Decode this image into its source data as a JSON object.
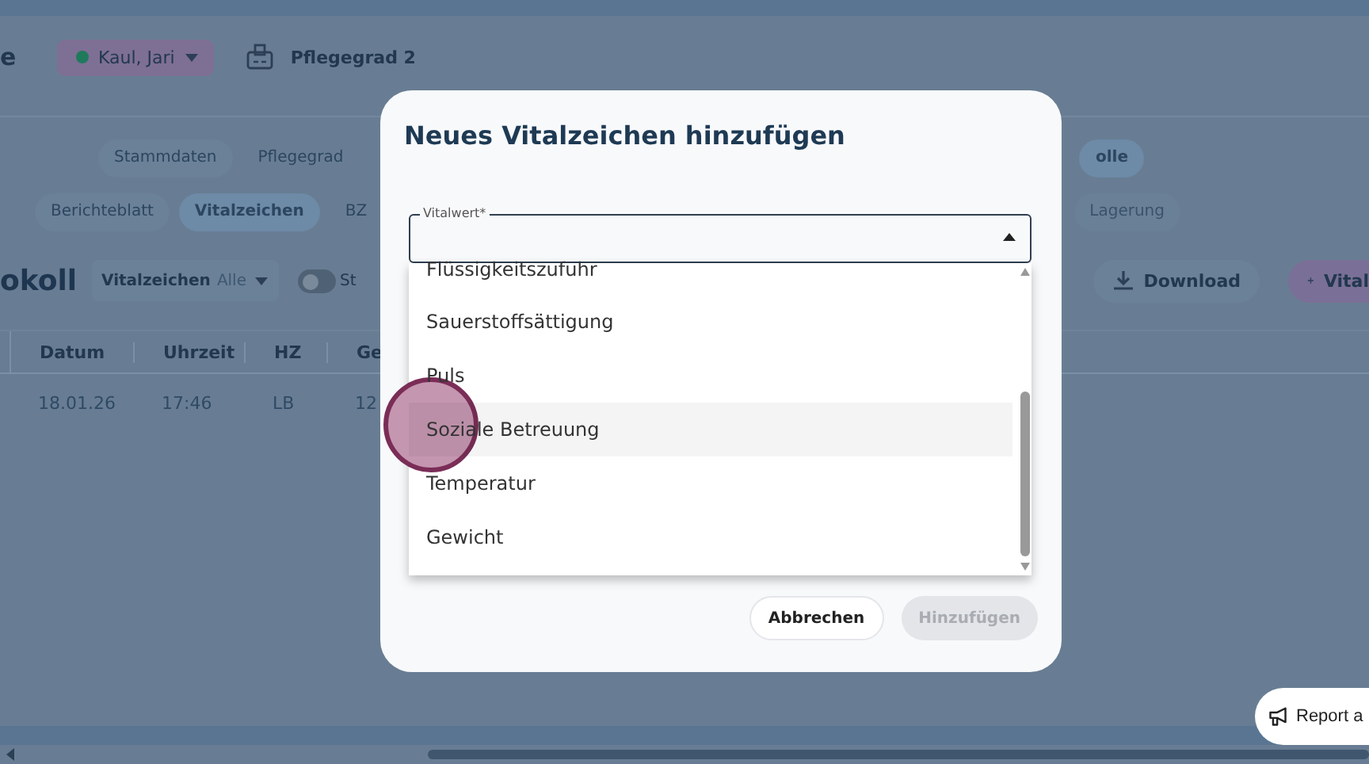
{
  "header": {
    "title_fragment": "e",
    "resident": {
      "name": "Kaul, Jari",
      "color": "#1f7a5c"
    },
    "care_level": "Pflegegrad 2"
  },
  "tabs_primary": [
    {
      "label": "Stammdaten",
      "selected": false
    },
    {
      "label": "Pflegegrad",
      "selected": false
    },
    {
      "label": "olle",
      "selected": true
    }
  ],
  "tabs_secondary": [
    {
      "label": "Berichteblatt",
      "selected": false,
      "disabled": false
    },
    {
      "label": "Vitalzeichen",
      "selected": true,
      "disabled": false
    },
    {
      "label": "BZ",
      "selected": false,
      "disabled": false
    },
    {
      "label": "Lagerung",
      "selected": false,
      "disabled": true
    }
  ],
  "protocol": {
    "title": "okoll",
    "filter": {
      "label": "Vitalzeichen",
      "value": "Alle"
    },
    "toggle": {
      "label": "St",
      "on": false
    },
    "buttons": [
      {
        "label": "Download",
        "kind": "download"
      },
      {
        "label": "Vital",
        "kind": "add"
      }
    ]
  },
  "table": {
    "columns": [
      "Datum",
      "Uhrzeit",
      "HZ",
      "Ge"
    ],
    "rows": [
      [
        "18.01.26",
        "17:46",
        "LB",
        "12"
      ]
    ]
  },
  "dialog": {
    "title": "Neues Vitalzeichen hinzufügen",
    "field": {
      "label": "Vitalwert*",
      "expanded": true
    },
    "options": [
      {
        "label": "Flüssigkeitszufuhr",
        "highlighted": false
      },
      {
        "label": "Sauerstoffsättigung",
        "highlighted": false
      },
      {
        "label": "Puls",
        "highlighted": false
      },
      {
        "label": "Soziale Betreuung",
        "highlighted": true
      },
      {
        "label": "Temperatur",
        "highlighted": false
      },
      {
        "label": "Gewicht",
        "highlighted": false
      }
    ],
    "buttons": [
      {
        "label": "Abbrechen",
        "kind": "secondary",
        "disabled": false
      },
      {
        "label": "Hinzufügen",
        "kind": "primary",
        "disabled": true
      }
    ]
  },
  "report_button": {
    "label": "Report a"
  }
}
